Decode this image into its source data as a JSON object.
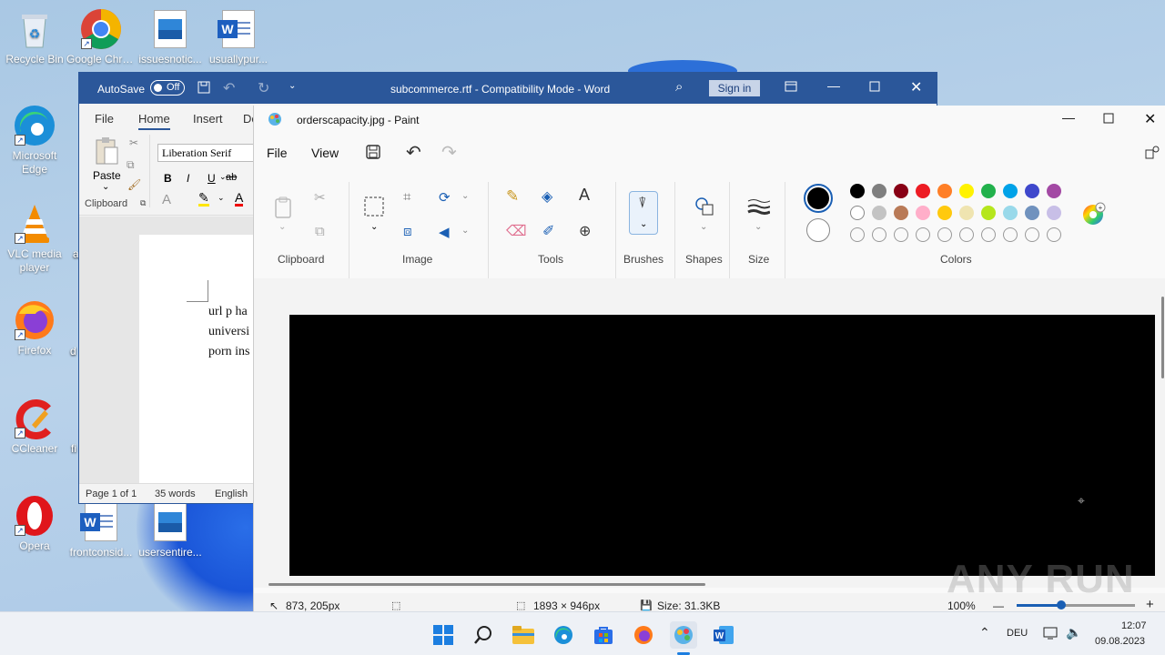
{
  "desktop": {
    "icons": [
      {
        "label": "Recycle Bin",
        "icon": "recycle-bin-icon"
      },
      {
        "label": "Google Chrome",
        "icon": "chrome-icon"
      },
      {
        "label": "issuesnotic...",
        "icon": "image-file-icon"
      },
      {
        "label": "usuallypur...",
        "icon": "word-file-icon"
      },
      {
        "label": "Microsoft Edge",
        "icon": "edge-icon"
      },
      {
        "label": "VLC media player",
        "icon": "vlc-icon"
      },
      {
        "label": "Firefox",
        "icon": "firefox-icon"
      },
      {
        "label": "CCleaner",
        "icon": "ccleaner-icon"
      },
      {
        "label": "Opera",
        "icon": "opera-icon"
      },
      {
        "label": "frontconsid...",
        "icon": "word-file-icon"
      },
      {
        "label": "usersentire...",
        "icon": "image-file-icon"
      }
    ],
    "partial_labels": [
      "a",
      "d",
      "fi"
    ]
  },
  "word": {
    "autosave_label": "AutoSave",
    "autosave_state": "Off",
    "title": "subcommerce.rtf  -  Compatibility Mode  -  Word",
    "signin": "Sign in",
    "tabs": [
      "File",
      "Home",
      "Insert",
      "De"
    ],
    "paste_label": "Paste",
    "clipboard_label": "Clipboard",
    "font": "Liberation Serif",
    "bold": "B",
    "italic": "I",
    "underline": "U",
    "strike": "ab",
    "font_a": "A",
    "doc_lines": [
      "url p ha",
      "universi",
      "porn ins"
    ],
    "status": {
      "page": "Page 1 of 1",
      "words": "35 words",
      "lang": "English"
    }
  },
  "paint": {
    "title": "orderscapacity.jpg - Paint",
    "menu": [
      "File",
      "View"
    ],
    "groups": [
      "Clipboard",
      "Image",
      "Tools",
      "Brushes",
      "Shapes",
      "Size",
      "Colors"
    ],
    "text_tool": "A",
    "palette_row1": [
      "#000000",
      "#7f7f7f",
      "#880015",
      "#ed1c24",
      "#ff7f27",
      "#fff200",
      "#22b14c",
      "#00a2e8",
      "#3f48cc",
      "#a349a4"
    ],
    "palette_row2": [
      "#ffffff",
      "#c3c3c3",
      "#b97a57",
      "#ffaec9",
      "#ffc90e",
      "#efe4b0",
      "#b5e61d",
      "#99d9ea",
      "#7092be",
      "#c8bfe7"
    ],
    "status": {
      "cursor": "873, 205px",
      "dims": "1893 × 946px",
      "size": "Size: 31.3KB",
      "zoom": "100%"
    }
  },
  "taskbar": {
    "apps": [
      "start-icon",
      "search-icon",
      "file-explorer-icon",
      "edge-icon",
      "store-icon",
      "firefox-icon",
      "paint-icon",
      "word-icon"
    ],
    "lang": "DEU",
    "time": "12:07",
    "date": "09.08.2023"
  },
  "watermark": "ANY RUN"
}
